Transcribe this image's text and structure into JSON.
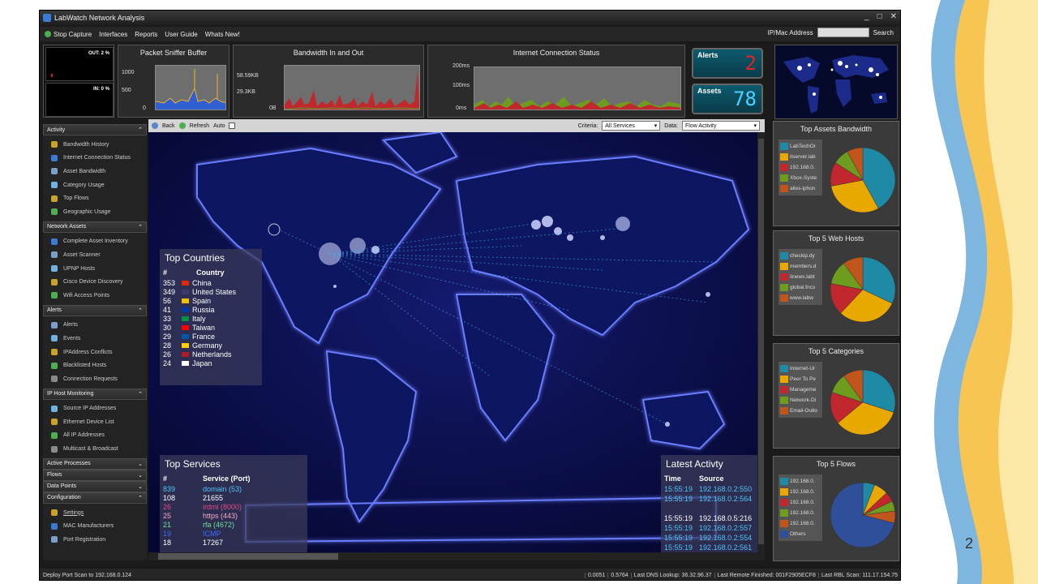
{
  "slide": {
    "number": "2"
  },
  "app": {
    "title": "LabWatch Network Analysis",
    "window_controls": [
      "_",
      "□",
      "✕"
    ]
  },
  "menu": {
    "items": [
      "Stop Capture",
      "Interfaces",
      "Reports",
      "User Guide",
      "Whats New!"
    ],
    "ip_label": "IP/Mac Address",
    "ip_value": "",
    "search_label": "Search"
  },
  "top": {
    "gauges": {
      "out": "OUT: 2 %",
      "in": "IN: 0 %"
    },
    "packet": {
      "title": "Packet Sniffer Buffer",
      "y_ticks": [
        "1000",
        "500",
        "0"
      ]
    },
    "bandwidth": {
      "title": "Bandwidth In and Out",
      "y_ticks": [
        "58.59KB",
        "29.3KB",
        "0B"
      ]
    },
    "internet": {
      "title": "Internet Connection Status",
      "y_ticks": [
        "200ms",
        "100ms",
        "0ms"
      ]
    },
    "alerts": {
      "label": "Alerts",
      "value": "2"
    },
    "assets": {
      "label": "Assets",
      "value": "78"
    }
  },
  "sidebar": {
    "sections": [
      {
        "title": "Activity",
        "items": [
          "Bandwidth History",
          "Internet Connection Status",
          "Asset Bandwidth",
          "Category Usage",
          "Top Flows",
          "Geographic Usage"
        ]
      },
      {
        "title": "Network Assets",
        "items": [
          "Complete Asset Inventory",
          "Asset Scanner",
          "UPNP Hosts",
          "Cisco Device Discovery",
          "Wifi Access Points"
        ]
      },
      {
        "title": "Alerts",
        "items": [
          "Alerts",
          "Events",
          "IPAddress Conflicts",
          "Blacklisted Hosts",
          "Connection Requests"
        ]
      },
      {
        "title": "IP Host Monitoring",
        "items": [
          "Source IP Addresses",
          "Ethernet Device List",
          "All IP Addresses",
          "Multicast & Broadcast"
        ]
      },
      {
        "title": "Active Processes",
        "items": []
      },
      {
        "title": "Flows",
        "items": []
      },
      {
        "title": "Data Points",
        "items": []
      },
      {
        "title": "Configuration",
        "items": [
          "Settings",
          "MAC Manufacturers",
          "Port Registration"
        ]
      }
    ]
  },
  "toolbar": {
    "back": "Back",
    "refresh": "Refresh",
    "auto": "Auto",
    "criteria_label": "Criteria:",
    "criteria_value": "All Services",
    "data_label": "Data:",
    "data_value": "Flow Activity"
  },
  "top_countries": {
    "title": "Top Countries",
    "headers": [
      "#",
      "Country"
    ],
    "rows": [
      {
        "n": "353",
        "country": "China",
        "flag": "#de2910"
      },
      {
        "n": "349",
        "country": "United States",
        "flag": "#3c3b6e"
      },
      {
        "n": "56",
        "country": "Spain",
        "flag": "#f1bf00"
      },
      {
        "n": "41",
        "country": "Russia",
        "flag": "#0039a6"
      },
      {
        "n": "33",
        "country": "Italy",
        "flag": "#009246"
      },
      {
        "n": "30",
        "country": "Taiwan",
        "flag": "#fe0000"
      },
      {
        "n": "29",
        "country": "France",
        "flag": "#0055a4"
      },
      {
        "n": "28",
        "country": "Germany",
        "flag": "#ffce00"
      },
      {
        "n": "26",
        "country": "Netherlands",
        "flag": "#ae1c28"
      },
      {
        "n": "24",
        "country": "Japan",
        "flag": "#ffffff"
      }
    ]
  },
  "top_services": {
    "title": "Top Services",
    "headers": [
      "#",
      "Service (Port)"
    ],
    "rows": [
      {
        "n": "839",
        "service": "domain (53)",
        "color": "#4fc3f7"
      },
      {
        "n": "108",
        "service": "21655",
        "color": "#ffffff"
      },
      {
        "n": "26",
        "service": "irdmi (8000)",
        "color": "#e24b8a"
      },
      {
        "n": "25",
        "service": "https (443)",
        "color": "#f4a9c8"
      },
      {
        "n": "21",
        "service": "rfa (4672)",
        "color": "#6fe0a0"
      },
      {
        "n": "19",
        "service": "ICMP",
        "color": "#3b6cff"
      },
      {
        "n": "18",
        "service": "17267",
        "color": "#ffffff"
      }
    ]
  },
  "latest_activity": {
    "title": "Latest Activty",
    "headers": [
      "Time",
      "Source"
    ],
    "rows": [
      {
        "time": "15:55:19",
        "source": "192.168.0.2:550",
        "color": "#4fc3f7"
      },
      {
        "time": "15:55:19",
        "source": "192.168.0.2:564",
        "color": "#4fc3f7"
      },
      {
        "time": "",
        "source": "",
        "color": "#4fc3f7"
      },
      {
        "time": "15:55:19",
        "source": "192.168.0.5:216",
        "color": "#ffffff"
      },
      {
        "time": "15:55:19",
        "source": "192.168.0.2:557",
        "color": "#4fc3f7"
      },
      {
        "time": "15:55:19",
        "source": "192.168.0.2:554",
        "color": "#4fc3f7"
      },
      {
        "time": "15:55:19",
        "source": "192.168.0.2:561",
        "color": "#4fc3f7"
      }
    ]
  },
  "right": {
    "panels": [
      {
        "title": "Top Assets Bandwidth",
        "legend": [
          "LabTechOr",
          "itserver.lab",
          "192.168.0.",
          "Xbox-Syste",
          "alies-iphon"
        ],
        "slices": [
          0.42,
          0.3,
          0.12,
          0.08,
          0.08
        ]
      },
      {
        "title": "Top 5 Web Hosts",
        "legend": [
          "checkip.dy",
          "members.d",
          "itnews.labt",
          "global.fncs",
          "www.labw"
        ],
        "slices": [
          0.32,
          0.3,
          0.16,
          0.12,
          0.1
        ]
      },
      {
        "title": "Top 5 Categories",
        "legend": [
          "Internet-Ur",
          "Peer To Pe",
          "Manageme",
          "Network-Di",
          "Email-Outlo"
        ],
        "slices": [
          0.3,
          0.34,
          0.16,
          0.1,
          0.1
        ]
      },
      {
        "title": "Top 5 Flows",
        "legend": [
          "192.168.0.",
          "192.168.0.",
          "192.168.0.",
          "192.168.0.",
          "192.168.0.",
          "Others"
        ],
        "slices": [
          0.06,
          0.07,
          0.05,
          0.05,
          0.06,
          0.71
        ]
      }
    ],
    "colors": [
      "#1f8aa6",
      "#e8a800",
      "#c0282d",
      "#6d9c1f",
      "#c0561c",
      "#2f4f9a"
    ]
  },
  "status": {
    "left": "Deploy Port Scan to  192.168.0.124",
    "segments": [
      "0.0051",
      "0.5764",
      "Last DNS Lookup: 36.32.96.37",
      "Last Remote Finished: 001F2905ECF8",
      "Last RBL Scan: 111.17.154.75"
    ]
  }
}
